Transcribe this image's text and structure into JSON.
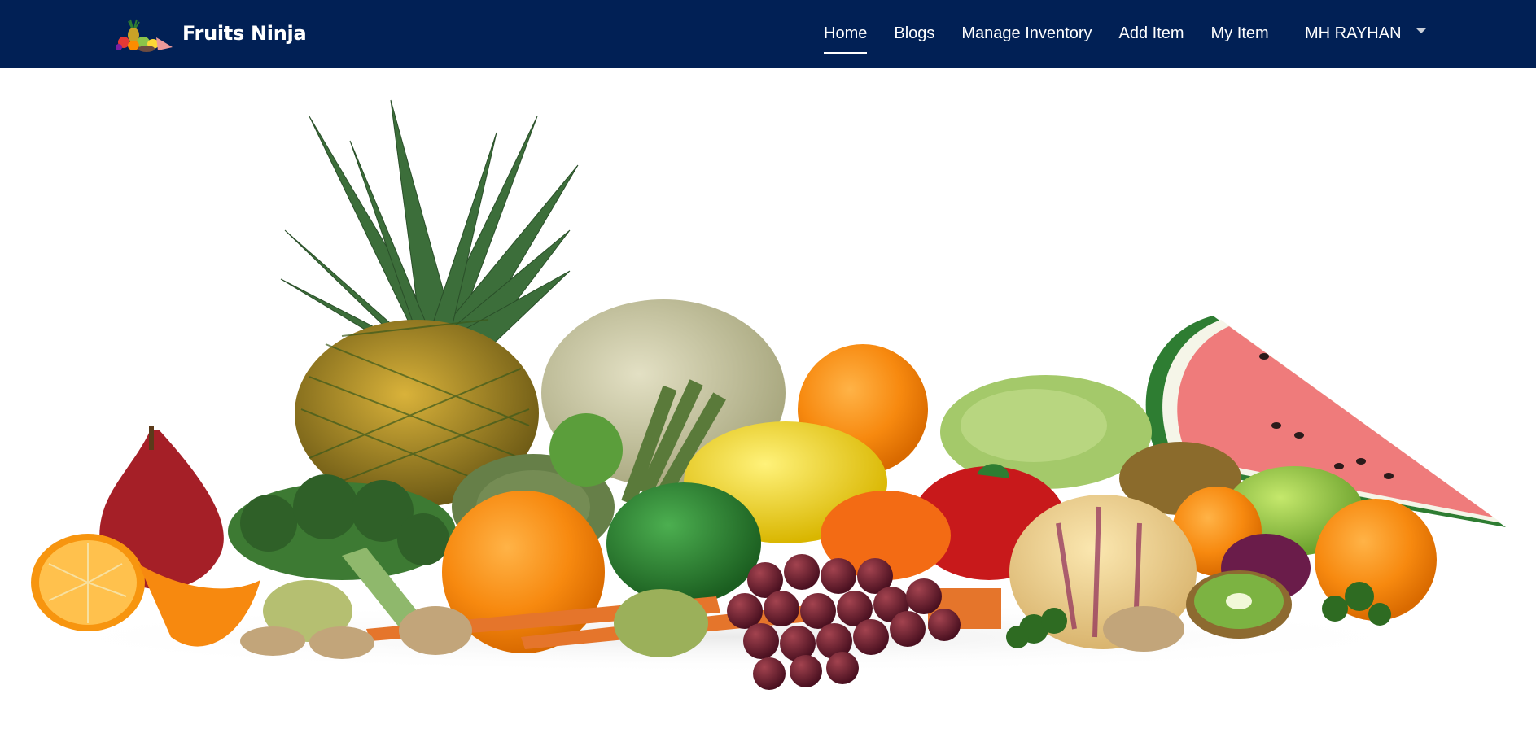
{
  "brand": {
    "name": "Fruits Ninja"
  },
  "nav": {
    "items": [
      {
        "label": "Home",
        "active": true
      },
      {
        "label": "Blogs",
        "active": false
      },
      {
        "label": "Manage Inventory",
        "active": false
      },
      {
        "label": "Add Item",
        "active": false
      },
      {
        "label": "My Item",
        "active": false
      }
    ]
  },
  "user": {
    "name": "MH RAYHAN"
  },
  "colors": {
    "navbar": "#012055",
    "nav_text": "#ffffff"
  }
}
